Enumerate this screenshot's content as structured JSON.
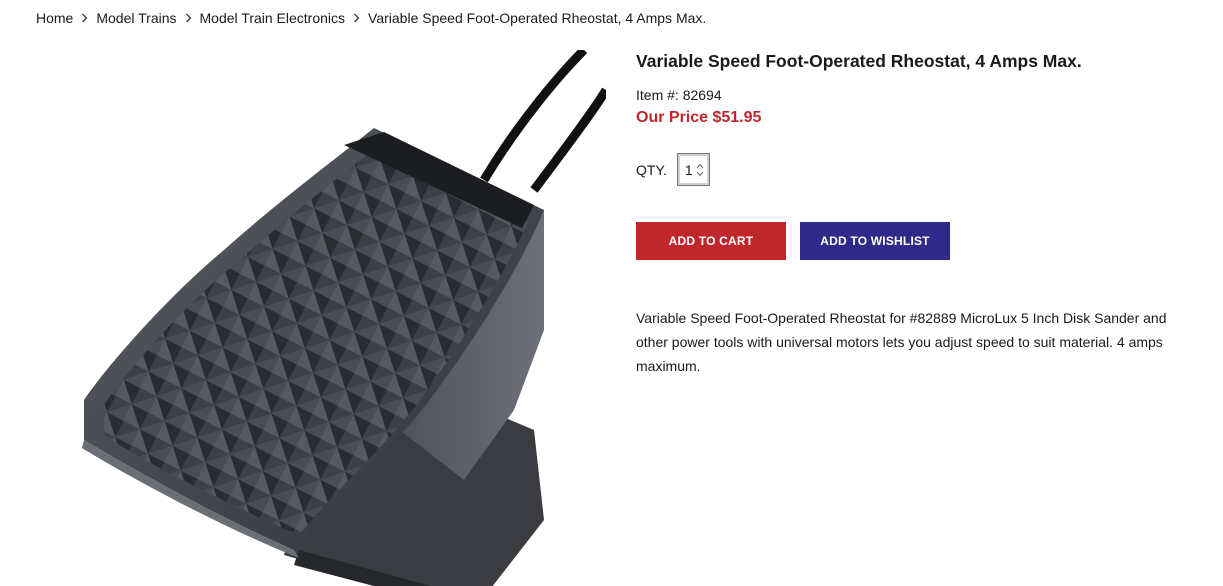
{
  "breadcrumb": {
    "items": [
      "Home",
      "Model Trains",
      "Model Train Electronics"
    ],
    "current": "Variable Speed Foot-Operated Rheostat, 4 Amps Max."
  },
  "product": {
    "title": "Variable Speed Foot-Operated Rheostat, 4 Amps Max.",
    "item_label": "Item #:",
    "item_number": "82694",
    "price_label": "Our Price",
    "price": "$51.95",
    "qty_label": "QTY.",
    "qty_value": "1",
    "add_to_cart": "ADD TO CART",
    "add_to_wishlist": "ADD TO WISHLIST",
    "description": "Variable Speed Foot-Operated Rheostat for #82889 MicroLux 5 Inch Disk Sander and other power tools with universal motors lets you adjust speed to suit material. 4 amps maximum."
  },
  "colors": {
    "price": "#c0272d",
    "cart_button": "#c0272d",
    "wishlist_button": "#2e2a8a"
  },
  "icons": {
    "breadcrumb_separator": "chevron-right-icon",
    "qty_spinner": "spinner-arrows-icon"
  }
}
